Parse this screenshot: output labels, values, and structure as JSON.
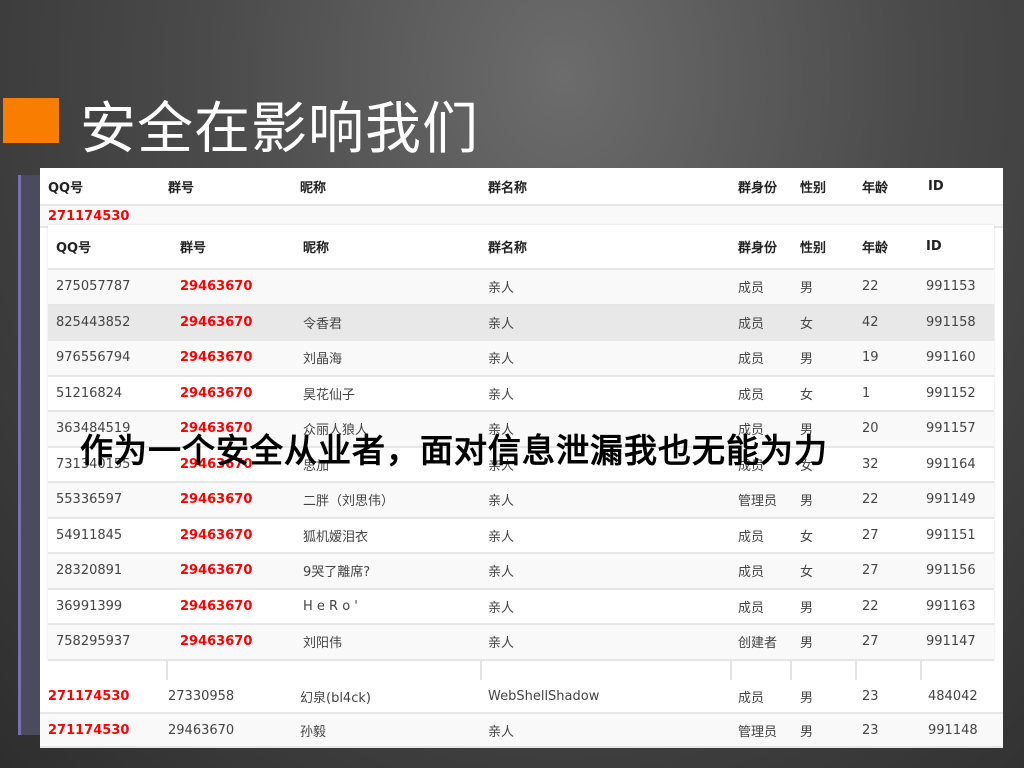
{
  "slide": {
    "title": "安全在影响我们",
    "caption": "作为一个安全从业者，面对信息泄漏我也无能为力",
    "accent_color": "#f97d00"
  },
  "table_headers": [
    "QQ号",
    "群号",
    "昵称",
    "群名称",
    "群身份",
    "性别",
    "年龄",
    "ID"
  ],
  "back_table": {
    "top_rows": [
      {
        "qq": "271174530"
      }
    ],
    "bottom_rows": [
      [
        "271174530",
        "27330958",
        "幻泉(bl4ck)",
        "WebShellShadow",
        "成员",
        "男",
        "23",
        "484042"
      ],
      [
        "271174530",
        "29463670",
        "孙毅",
        "亲人",
        "管理员",
        "男",
        "23",
        "991148"
      ]
    ]
  },
  "front_table": {
    "rows": [
      [
        "275057787",
        "29463670",
        "",
        "亲人",
        "成员",
        "男",
        "22",
        "991153"
      ],
      [
        "825443852",
        "29463670",
        "令香君",
        "亲人",
        "成员",
        "女",
        "42",
        "991158"
      ],
      [
        "976556794",
        "29463670",
        "刘晶海",
        "亲人",
        "成员",
        "男",
        "19",
        "991160"
      ],
      [
        "51216824",
        "29463670",
        "昊花仙子",
        "亲人",
        "成员",
        "女",
        "1",
        "991152"
      ],
      [
        "363484519",
        "29463670",
        "众丽人狼人",
        "亲人",
        "成员",
        "男",
        "20",
        "991157"
      ],
      [
        "731340155",
        "29463670",
        "思加",
        "亲人",
        "成员",
        "女",
        "32",
        "991164"
      ],
      [
        "55336597",
        "29463670",
        "二胖（刘思伟）",
        "亲人",
        "管理员",
        "男",
        "22",
        "991149"
      ],
      [
        "54911845",
        "29463670",
        "狐机嫒泪衣",
        "亲人",
        "成员",
        "女",
        "27",
        "991151"
      ],
      [
        "28320891",
        "29463670",
        "9哭了離席?",
        "亲人",
        "成员",
        "女",
        "27",
        "991156"
      ],
      [
        "36991399",
        "29463670",
        "H e R o '",
        "亲人",
        "成员",
        "男",
        "22",
        "991163"
      ],
      [
        "758295937",
        "29463670",
        "刘阳伟",
        "亲人",
        "创建者",
        "男",
        "27",
        "991147"
      ]
    ],
    "highlighted_row": 1
  }
}
